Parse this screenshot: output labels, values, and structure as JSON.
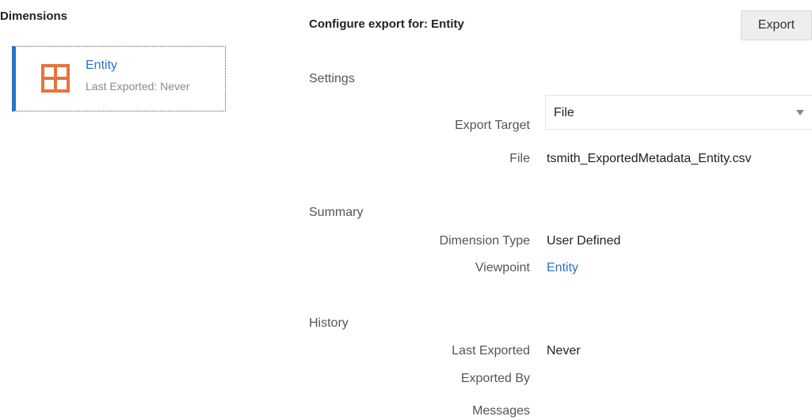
{
  "left_panel": {
    "heading": "Dimensions",
    "dimension_card": {
      "name": "Entity",
      "subtitle": "Last Exported: Never",
      "icon": "grid-icon",
      "icon_color": "#e8733a",
      "accent_color": "#2b72c4"
    }
  },
  "main": {
    "title": "Configure export for: Entity",
    "export_button": "Export",
    "settings": {
      "heading": "Settings",
      "export_target_label": "Export Target",
      "export_target_value": "File",
      "file_label": "File",
      "file_value": "tsmith_ExportedMetadata_Entity.csv"
    },
    "summary": {
      "heading": "Summary",
      "dimension_type_label": "Dimension Type",
      "dimension_type_value": "User Defined",
      "viewpoint_label": "Viewpoint",
      "viewpoint_value": "Entity"
    },
    "history": {
      "heading": "History",
      "last_exported_label": "Last Exported",
      "last_exported_value": "Never",
      "exported_by_label": "Exported By",
      "messages_label": "Messages"
    }
  }
}
